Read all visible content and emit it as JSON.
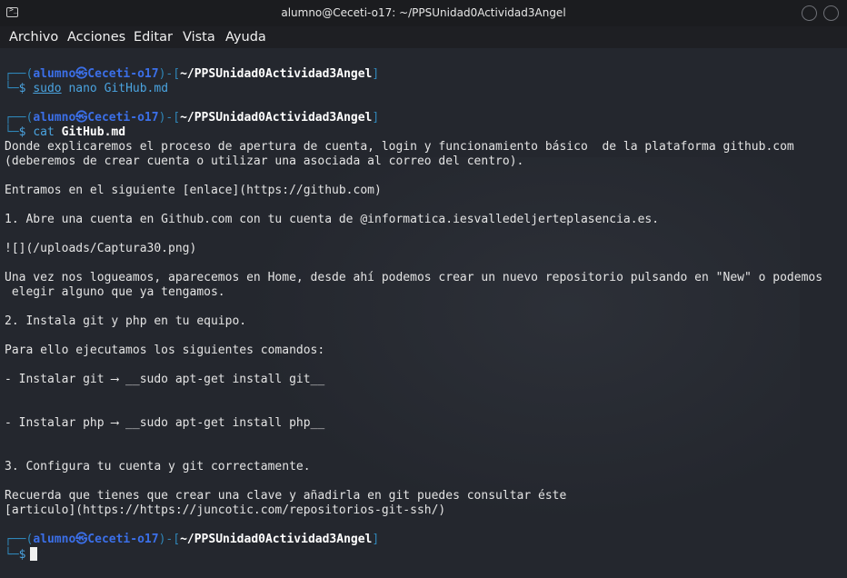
{
  "window": {
    "title": "alumno@Ceceti-o17: ~/PPSUnidad0Actividad3Angel",
    "app_icon": "terminal-icon"
  },
  "menu": [
    "Archivo",
    "Acciones",
    "Editar",
    "Vista",
    "Ayuda"
  ],
  "prompt": {
    "open": "┌──(",
    "user": "alumno",
    "at": "㉿",
    "host": "Ceceti-o17",
    "mid": ")-[",
    "path": "~/PPSUnidad0Actividad3Angel",
    "close": "]",
    "second": "└─",
    "dollar": "$"
  },
  "commands": [
    {
      "cmd": "sudo",
      "args": "nano GitHub.md"
    },
    {
      "cmd": "cat",
      "args": "GitHub.md"
    }
  ],
  "output": [
    "Donde explicaremos el proceso de apertura de cuenta, login y funcionamiento básico  de la plataforma github.com",
    "(deberemos de crear cuenta o utilizar una asociada al correo del centro).",
    "",
    "Entramos en el siguiente [enlace](https://github.com)",
    "",
    "1. Abre una cuenta en Github.com con tu cuenta de @informatica.iesvalledeljerteplasencia.es.",
    "",
    "![](/uploads/Captura30.png)",
    "",
    "Una vez nos logueamos, aparecemos en Home, desde ahí podemos crear un nuevo repositorio pulsando en \"New\" o podemos",
    " elegir alguno que ya tengamos.",
    "",
    "2. Instala git y php en tu equipo.",
    "",
    "Para ello ejecutamos los siguientes comandos:",
    "",
    "- Instalar git ⟶ __sudo apt-get install git__",
    "",
    "",
    "- Instalar php ⟶ __sudo apt-get install php__",
    "",
    "",
    "3. Configura tu cuenta y git correctamente.",
    "",
    "Recuerda que tienes que crear una clave y añadirla en git puedes consultar éste",
    "[articulo](https://https://juncotic.com/repositorios-git-ssh/)"
  ]
}
